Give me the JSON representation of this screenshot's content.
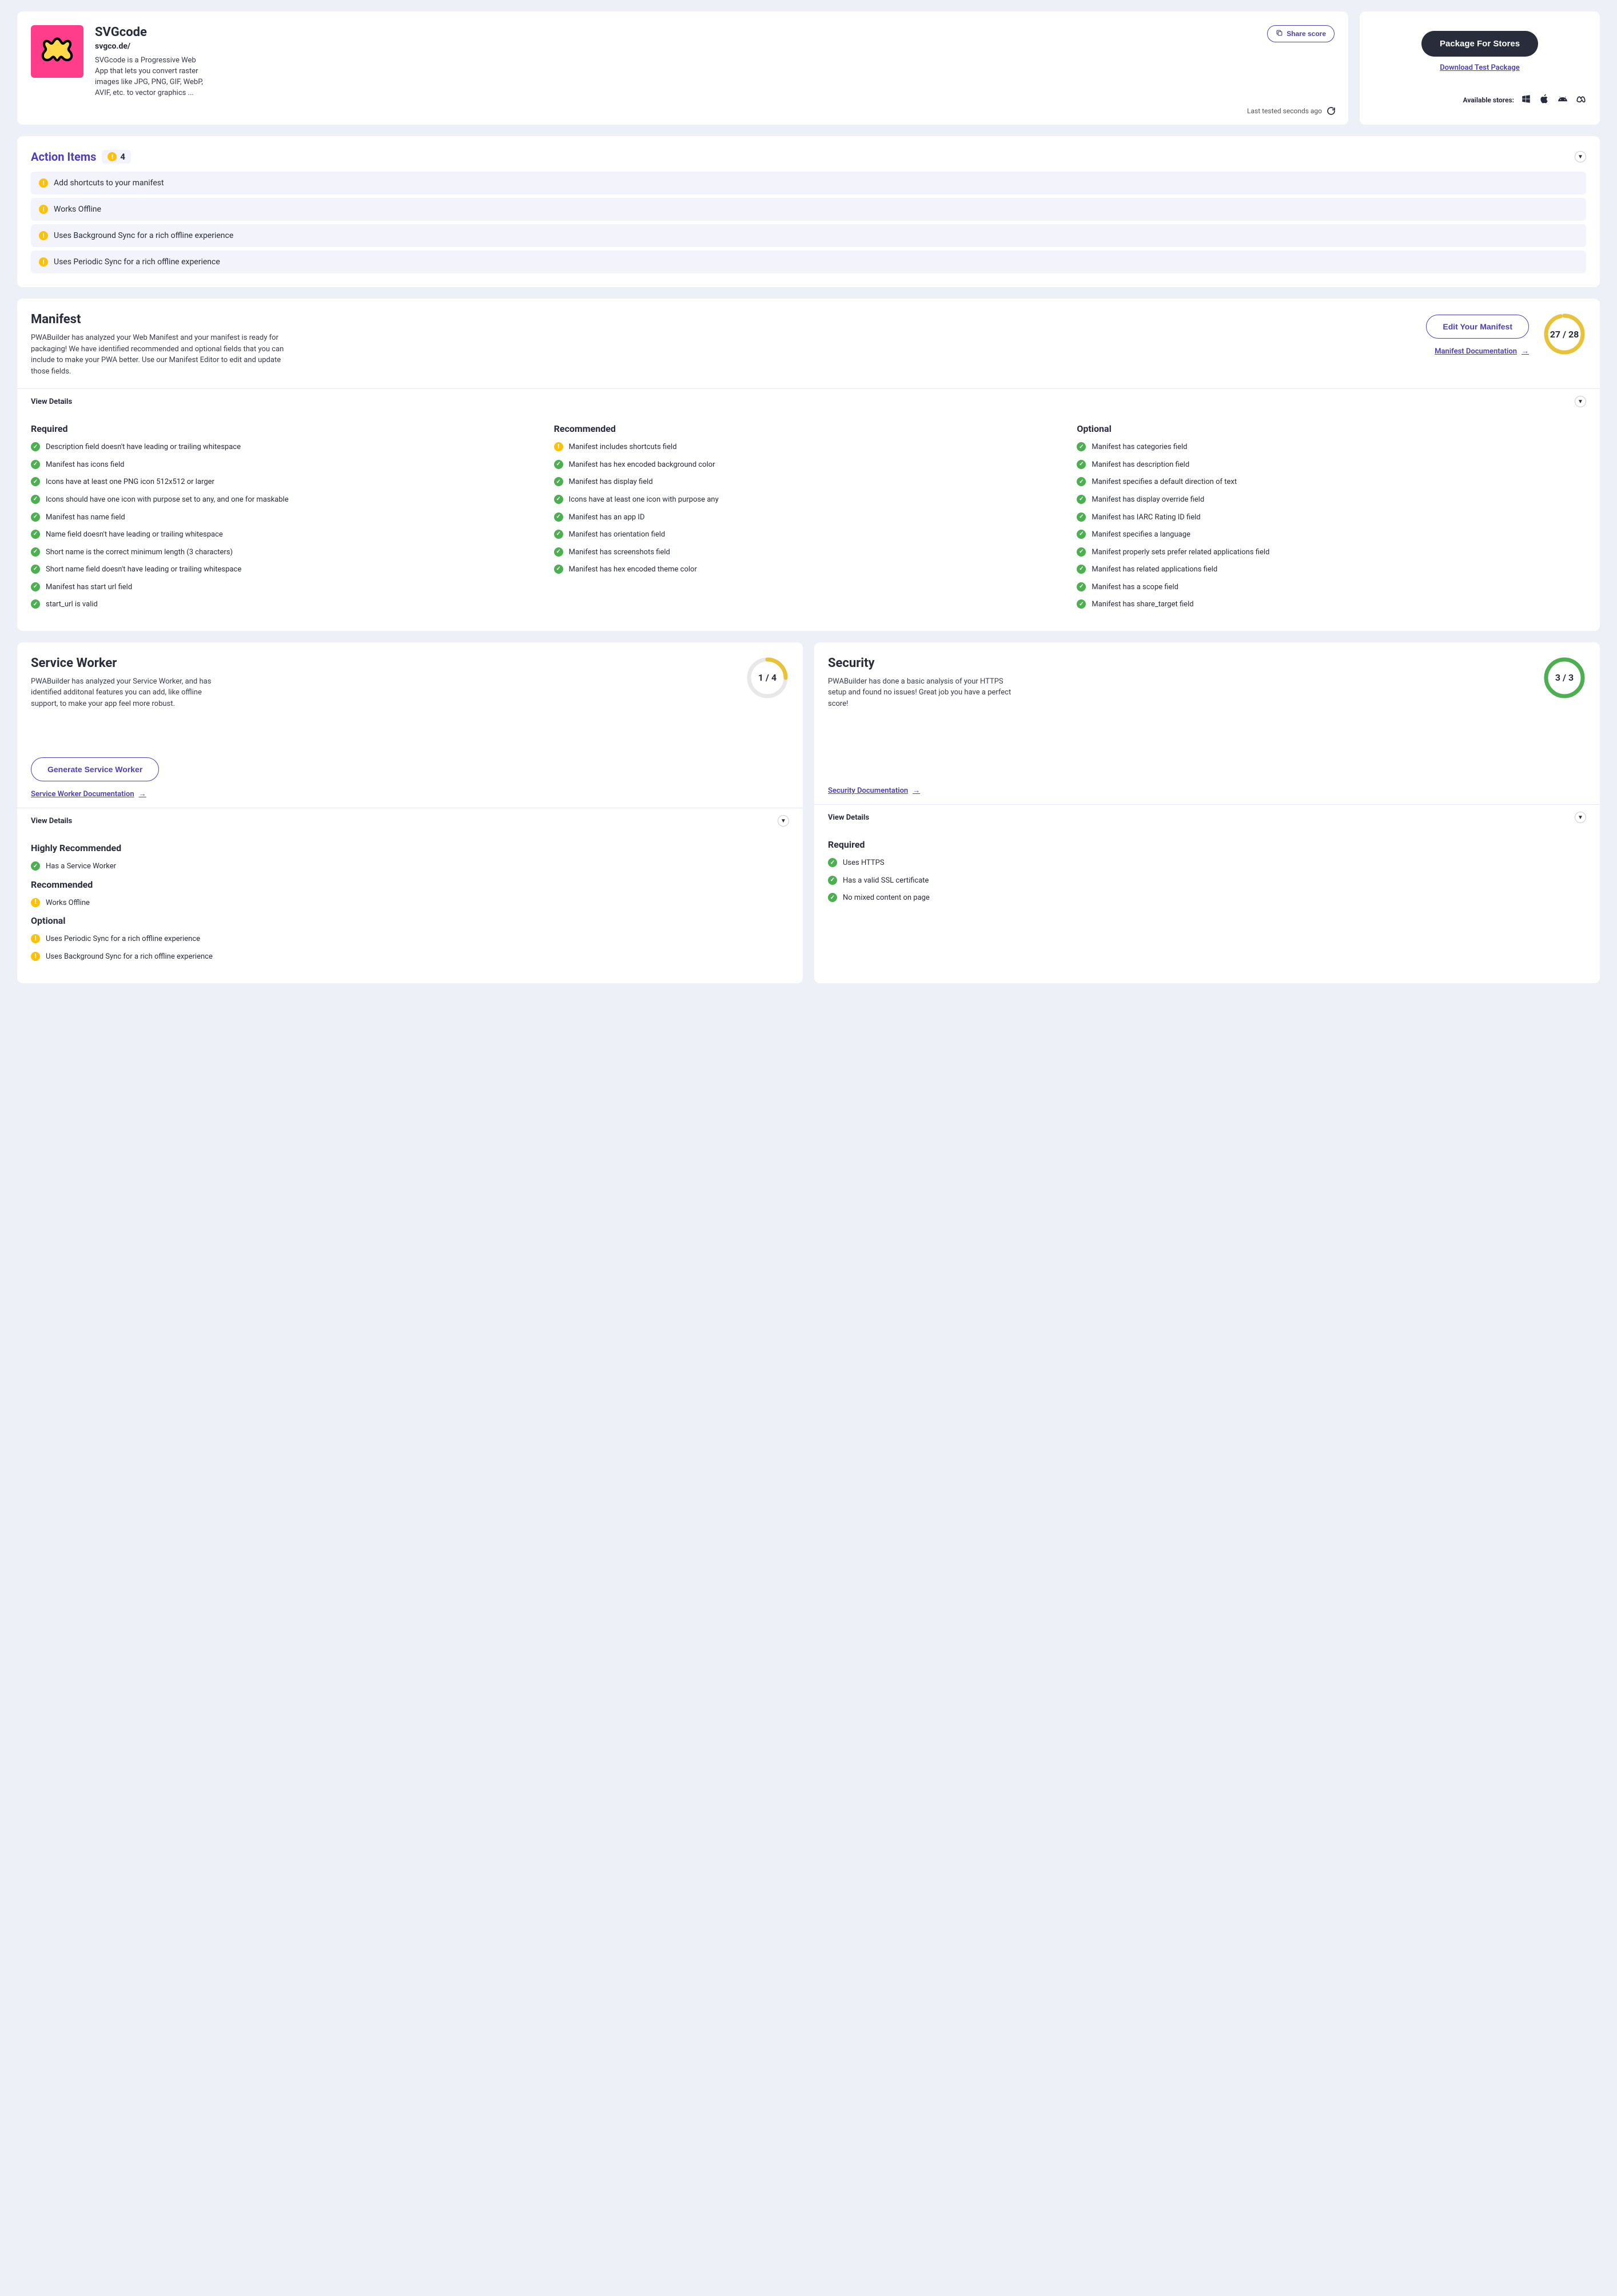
{
  "app": {
    "title": "SVGcode",
    "url": "svgco.de/",
    "description": "SVGcode is a Progressive Web App that lets you convert raster images like JPG, PNG, GIF, WebP, AVIF, etc. to vector graphics ...",
    "share_label": "Share score",
    "last_tested": "Last tested seconds ago"
  },
  "package": {
    "button": "Package For Stores",
    "download_test": "Download Test Package",
    "available_stores_label": "Available stores:"
  },
  "action_items": {
    "title": "Action Items",
    "count": "4",
    "items": [
      "Add shortcuts to your manifest",
      "Works Offline",
      "Uses Background Sync for a rich offline experience",
      "Uses Periodic Sync for a rich offline experience"
    ]
  },
  "manifest": {
    "title": "Manifest",
    "description": "PWABuilder has analyzed your Web Manifest and your manifest is ready for packaging! We have identified recommended and optional fields that you can include to make your PWA better. Use our Manifest Editor to edit and update those fields.",
    "edit_label": "Edit Your Manifest",
    "doc_label": "Manifest Documentation",
    "score": "27 / 28",
    "progress": 0.964,
    "view_details": "View Details",
    "required_title": "Required",
    "recommended_title": "Recommended",
    "optional_title": "Optional",
    "required": [
      {
        "ok": true,
        "text": "Description field doesn't have leading or trailing whitespace"
      },
      {
        "ok": true,
        "text": "Manifest has icons field"
      },
      {
        "ok": true,
        "text": "Icons have at least one PNG icon 512x512 or larger"
      },
      {
        "ok": true,
        "text": "Icons should have one icon with purpose set to any, and one for maskable"
      },
      {
        "ok": true,
        "text": "Manifest has name field"
      },
      {
        "ok": true,
        "text": "Name field doesn't have leading or trailing whitespace"
      },
      {
        "ok": true,
        "text": "Short name is the correct minimum length (3 characters)"
      },
      {
        "ok": true,
        "text": "Short name field doesn't have leading or trailing whitespace"
      },
      {
        "ok": true,
        "text": "Manifest has start url field"
      },
      {
        "ok": true,
        "text": "start_url is valid"
      }
    ],
    "recommended": [
      {
        "ok": false,
        "text": "Manifest includes shortcuts field"
      },
      {
        "ok": true,
        "text": "Manifest has hex encoded background color"
      },
      {
        "ok": true,
        "text": "Manifest has display field"
      },
      {
        "ok": true,
        "text": "Icons have at least one icon with purpose any"
      },
      {
        "ok": true,
        "text": "Manifest has an app ID"
      },
      {
        "ok": true,
        "text": "Manifest has orientation field"
      },
      {
        "ok": true,
        "text": "Manifest has screenshots field"
      },
      {
        "ok": true,
        "text": "Manifest has hex encoded theme color"
      }
    ],
    "optional": [
      {
        "ok": true,
        "text": "Manifest has categories field"
      },
      {
        "ok": true,
        "text": "Manifest has description field"
      },
      {
        "ok": true,
        "text": "Manifest specifies a default direction of text"
      },
      {
        "ok": true,
        "text": "Manifest has display override field"
      },
      {
        "ok": true,
        "text": "Manifest has IARC Rating ID field"
      },
      {
        "ok": true,
        "text": "Manifest specifies a language"
      },
      {
        "ok": true,
        "text": "Manifest properly sets prefer related applications field"
      },
      {
        "ok": true,
        "text": "Manifest has related applications field"
      },
      {
        "ok": true,
        "text": "Manifest has a scope field"
      },
      {
        "ok": true,
        "text": "Manifest has share_target field"
      }
    ]
  },
  "service_worker": {
    "title": "Service Worker",
    "description": "PWABuilder has analyzed your Service Worker, and has identified additonal features you can add, like offline support, to make your app feel more robust.",
    "score": "1 / 4",
    "progress": 0.25,
    "gen_label": "Generate Service Worker",
    "doc_label": "Service Worker Documentation",
    "view_details": "View Details",
    "groups": [
      {
        "title": "Highly Recommended",
        "items": [
          {
            "ok": true,
            "text": "Has a Service Worker"
          }
        ]
      },
      {
        "title": "Recommended",
        "items": [
          {
            "ok": false,
            "text": "Works Offline"
          }
        ]
      },
      {
        "title": "Optional",
        "items": [
          {
            "ok": false,
            "text": "Uses Periodic Sync for a rich offline experience"
          },
          {
            "ok": false,
            "text": "Uses Background Sync for a rich offline experience"
          }
        ]
      }
    ]
  },
  "security": {
    "title": "Security",
    "description": "PWABuilder has done a basic analysis of your HTTPS setup and found no issues! Great job you have a perfect score!",
    "score": "3 / 3",
    "progress": 1.0,
    "doc_label": "Security Documentation",
    "view_details": "View Details",
    "groups": [
      {
        "title": "Required",
        "items": [
          {
            "ok": true,
            "text": "Uses HTTPS"
          },
          {
            "ok": true,
            "text": "Has a valid SSL certificate"
          },
          {
            "ok": true,
            "text": "No mixed content on page"
          }
        ]
      }
    ]
  }
}
